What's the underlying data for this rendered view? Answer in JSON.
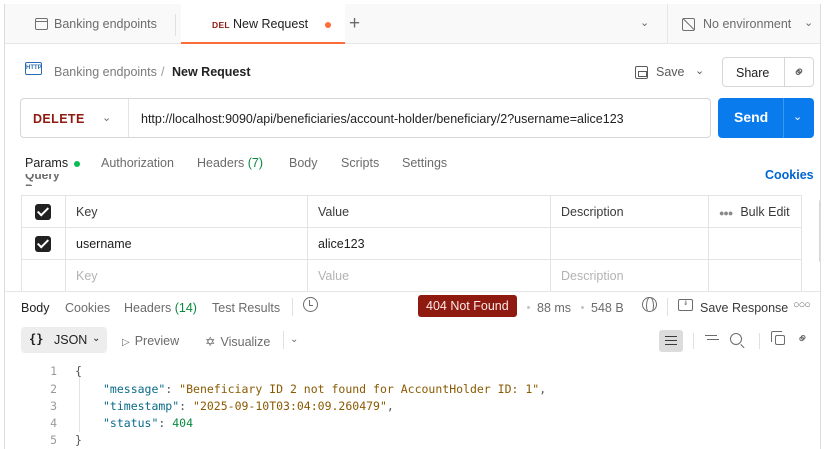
{
  "tabs": {
    "collection_tab": "Banking endpoints",
    "active_tab_method": "DEL",
    "active_tab_name": "New Request",
    "environment": "No environment"
  },
  "breadcrumb": {
    "collection": "Banking endpoints",
    "separator": "/",
    "request": "New Request",
    "save_label": "Save",
    "share_label": "Share"
  },
  "request": {
    "method": "DELETE",
    "url": "http://localhost:9090/api/beneficiaries/account-holder/beneficiary/2?username=alice123",
    "send_label": "Send"
  },
  "request_tabs": {
    "params": "Params",
    "authorization": "Authorization",
    "headers": "Headers",
    "headers_count": "(7)",
    "body": "Body",
    "scripts": "Scripts",
    "settings": "Settings",
    "cookies": "Cookies",
    "section_title_cut": "Query Params"
  },
  "params_table": {
    "headers": {
      "key": "Key",
      "value": "Value",
      "description": "Description",
      "bulk_edit": "Bulk Edit"
    },
    "rows": [
      {
        "checked": true,
        "key": "username",
        "value": "alice123",
        "description": ""
      }
    ],
    "placeholder": {
      "key": "Key",
      "value": "Value",
      "description": "Description"
    }
  },
  "response_tabs": {
    "body": "Body",
    "cookies": "Cookies",
    "headers": "Headers",
    "headers_count": "(14)",
    "test_results": "Test Results"
  },
  "response_meta": {
    "status": "404 Not Found",
    "time": "88 ms",
    "size": "548 B",
    "save_response": "Save Response",
    "status_color": "#8e1a10"
  },
  "response_toolbar": {
    "format": "JSON",
    "preview": "Preview",
    "visualize": "Visualize"
  },
  "response_body": {
    "line_numbers": [
      "1",
      "2",
      "3",
      "4",
      "5"
    ],
    "open_brace": "{",
    "close_brace": "}",
    "lines": [
      {
        "key": "\"message\"",
        "value": "\"Beneficiary ID 2 not found for AccountHolder ID: 1\"",
        "trail": ","
      },
      {
        "key": "\"timestamp\"",
        "value": "\"2025-09-10T03:04:09.260479\"",
        "trail": ","
      },
      {
        "key": "\"status\"",
        "value": "404",
        "trail": ""
      }
    ]
  },
  "colors": {
    "accent_orange": "#ff6c37",
    "send_blue": "#097bed",
    "delete_red": "#8e1a10",
    "link_blue": "#0265d2",
    "param_green": "#0cbb52"
  },
  "icons": [
    "collection-icon",
    "new-tab-plus-icon",
    "no-environment-icon",
    "http-icon",
    "save-icon",
    "link-icon",
    "history-icon",
    "globe-icon",
    "save-response-icon",
    "more-icon",
    "wrap-lines-icon",
    "filter-icon",
    "search-icon",
    "copy-icon"
  ]
}
